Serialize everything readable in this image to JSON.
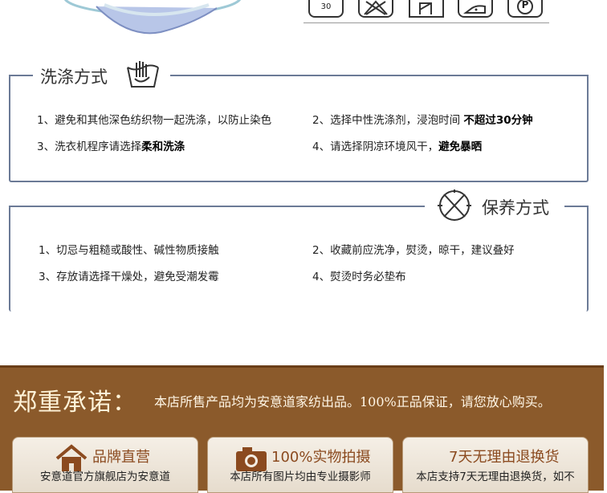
{
  "wash": {
    "title": "洗涤方式",
    "items": [
      {
        "text": "1、避免和其他深色纺织物一起洗涤，以防止染色",
        "bold": ""
      },
      {
        "text": "2、选择中性洗涤剂，浸泡时间 ",
        "bold": "不超过30分钟"
      },
      {
        "text": "3、洗衣机程序请选择",
        "bold": "柔和洗涤"
      },
      {
        "text": "4、请选择阴凉环境风干，",
        "bold": "避免暴晒"
      }
    ]
  },
  "care_icons": {
    "wash_temp": "30",
    "dryclean_letter": "P"
  },
  "maintain": {
    "title": "保养方式",
    "items": [
      "1、切忌与粗糙或酸性、碱性物质接触",
      "2、收藏前应洗净，熨烫，晾干，建议叠好",
      "3、存放请选择干燥处，避免受潮发霉",
      "4、熨烫时务必垫布"
    ]
  },
  "promise": {
    "title": "郑重承诺：",
    "text": "本店所售产品均为安意道家纺出品。100%正品保证，请您放心购买。",
    "cards": [
      {
        "title": "品牌直营",
        "desc": "安意道官方旗舰店为安意道"
      },
      {
        "title": "100%实物拍摄",
        "desc": "本店所有图片均由专业摄影师"
      },
      {
        "title": "7天无理由退换货",
        "desc": "本店支持7天无理由退换货，如不"
      }
    ]
  }
}
